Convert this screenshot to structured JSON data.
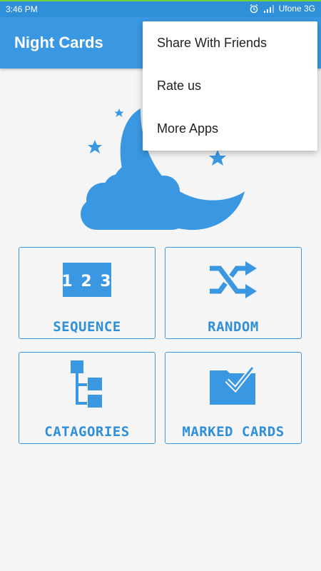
{
  "status_bar": {
    "time": "3:46 PM",
    "carrier": "Ufone 3G",
    "icons": [
      "alarm-icon",
      "signal-icon"
    ]
  },
  "app_bar": {
    "title": "Night Cards"
  },
  "menu": {
    "items": [
      {
        "label": "Share With Friends"
      },
      {
        "label": "Rate us"
      },
      {
        "label": "More Apps"
      }
    ]
  },
  "tiles": [
    {
      "label": "SEQUENCE",
      "icon": "numbers-123-icon",
      "icon_text": "1 2 3"
    },
    {
      "label": "RANDOM",
      "icon": "shuffle-icon"
    },
    {
      "label": "CATAGORIES",
      "icon": "tree-hierarchy-icon"
    },
    {
      "label": "MARKED CARDS",
      "icon": "folder-check-icon"
    }
  ],
  "colors": {
    "primary": "#3a98e3",
    "status_bar": "#2f8fd9",
    "accent_line": "#6cd43a",
    "background": "#f5f5f5",
    "tile_text": "#2f8fd9"
  }
}
